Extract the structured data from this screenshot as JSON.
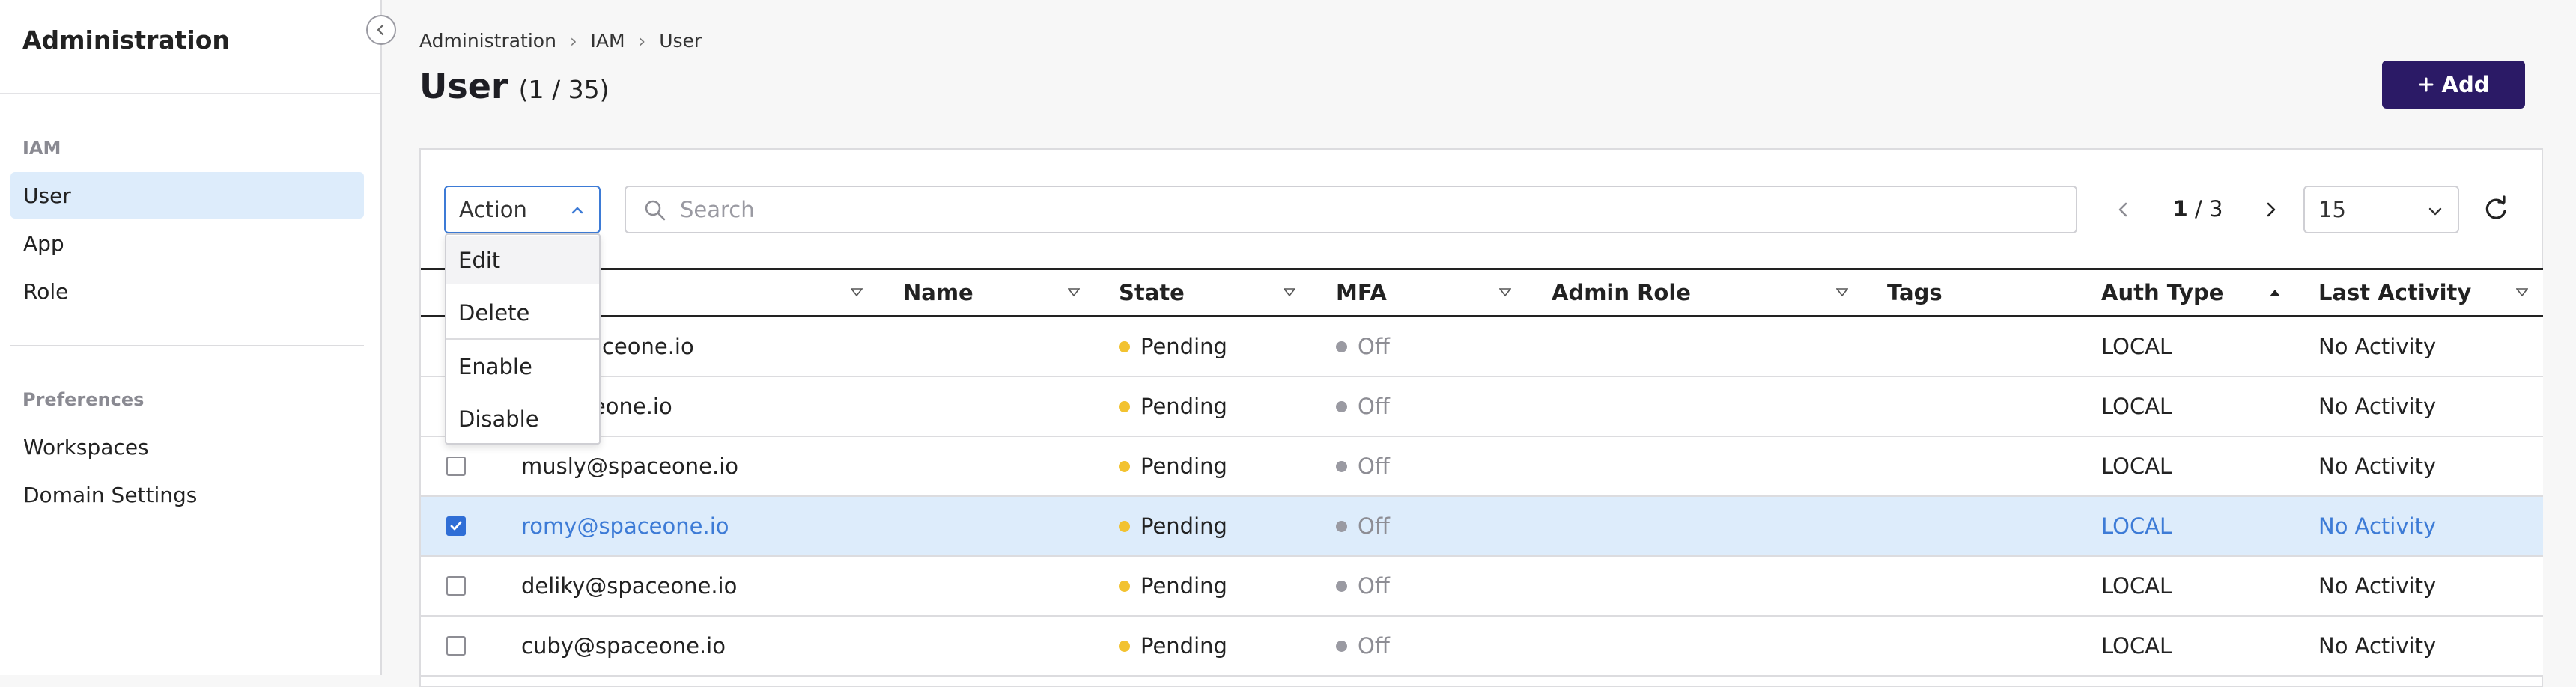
{
  "sidebar": {
    "title": "Administration",
    "sections": [
      {
        "label": "IAM",
        "items": [
          {
            "label": "User",
            "active": true
          },
          {
            "label": "App"
          },
          {
            "label": "Role"
          }
        ]
      },
      {
        "label": "Preferences",
        "items": [
          {
            "label": "Workspaces"
          },
          {
            "label": "Domain Settings"
          }
        ]
      }
    ]
  },
  "breadcrumb": [
    "Administration",
    "IAM",
    "User"
  ],
  "page": {
    "title": "User",
    "count": "(1 / 35)",
    "add_label": "Add"
  },
  "toolbar": {
    "action_label": "Action",
    "search_placeholder": "Search",
    "pager": {
      "current": "1",
      "total": "/ 3"
    },
    "page_size": "15"
  },
  "action_menu": [
    "Edit",
    "Delete",
    "Enable",
    "Disable"
  ],
  "table": {
    "columns": [
      "",
      "Name",
      "State",
      "MFA",
      "Admin Role",
      "Tags",
      "Auth Type",
      "Last Activity"
    ],
    "sorted_column": "Auth Type",
    "rows": [
      {
        "user_id": "...@spaceone.io",
        "state": "Pending",
        "mfa": "Off",
        "auth_type": "LOCAL",
        "last_activity": "No Activity",
        "checked": false
      },
      {
        "user_id": "...spaceone.io",
        "state": "Pending",
        "mfa": "Off",
        "auth_type": "LOCAL",
        "last_activity": "No Activity",
        "checked": false
      },
      {
        "user_id": "musly@spaceone.io",
        "state": "Pending",
        "mfa": "Off",
        "auth_type": "LOCAL",
        "last_activity": "No Activity",
        "checked": false
      },
      {
        "user_id": "romy@spaceone.io",
        "state": "Pending",
        "mfa": "Off",
        "auth_type": "LOCAL",
        "last_activity": "No Activity",
        "checked": true
      },
      {
        "user_id": "deliky@spaceone.io",
        "state": "Pending",
        "mfa": "Off",
        "auth_type": "LOCAL",
        "last_activity": "No Activity",
        "checked": false
      },
      {
        "user_id": "cuby@spaceone.io",
        "state": "Pending",
        "mfa": "Off",
        "auth_type": "LOCAL",
        "last_activity": "No Activity",
        "checked": false
      }
    ]
  },
  "colors": {
    "primary": "#2b1a66",
    "accent": "#3d7bd6",
    "pending_dot": "#f2c230",
    "off_dot": "#9a9aa2",
    "selected_row": "#ddecfb"
  }
}
